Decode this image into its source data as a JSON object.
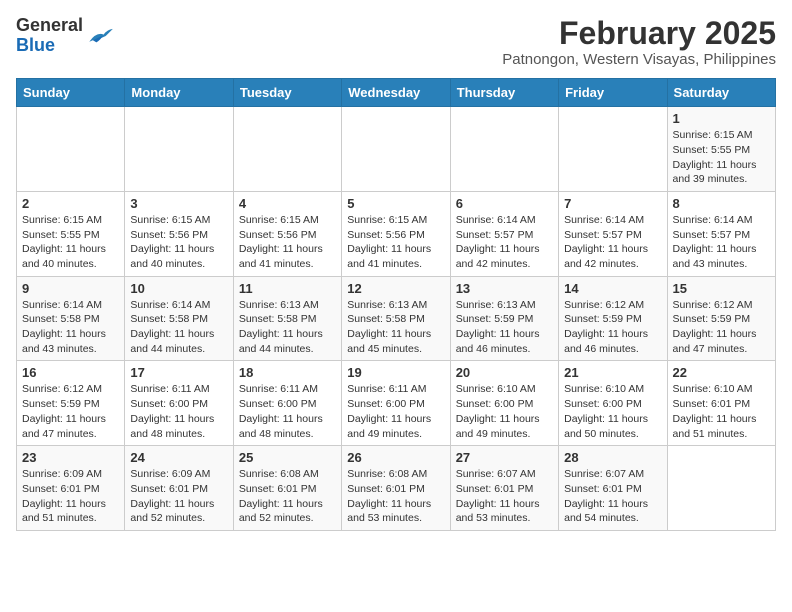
{
  "header": {
    "logo_general": "General",
    "logo_blue": "Blue",
    "title": "February 2025",
    "subtitle": "Patnongon, Western Visayas, Philippines"
  },
  "calendar": {
    "days_of_week": [
      "Sunday",
      "Monday",
      "Tuesday",
      "Wednesday",
      "Thursday",
      "Friday",
      "Saturday"
    ],
    "weeks": [
      [
        {
          "day": "",
          "info": ""
        },
        {
          "day": "",
          "info": ""
        },
        {
          "day": "",
          "info": ""
        },
        {
          "day": "",
          "info": ""
        },
        {
          "day": "",
          "info": ""
        },
        {
          "day": "",
          "info": ""
        },
        {
          "day": "1",
          "info": "Sunrise: 6:15 AM\nSunset: 5:55 PM\nDaylight: 11 hours and 39 minutes."
        }
      ],
      [
        {
          "day": "2",
          "info": "Sunrise: 6:15 AM\nSunset: 5:55 PM\nDaylight: 11 hours and 40 minutes."
        },
        {
          "day": "3",
          "info": "Sunrise: 6:15 AM\nSunset: 5:56 PM\nDaylight: 11 hours and 40 minutes."
        },
        {
          "day": "4",
          "info": "Sunrise: 6:15 AM\nSunset: 5:56 PM\nDaylight: 11 hours and 41 minutes."
        },
        {
          "day": "5",
          "info": "Sunrise: 6:15 AM\nSunset: 5:56 PM\nDaylight: 11 hours and 41 minutes."
        },
        {
          "day": "6",
          "info": "Sunrise: 6:14 AM\nSunset: 5:57 PM\nDaylight: 11 hours and 42 minutes."
        },
        {
          "day": "7",
          "info": "Sunrise: 6:14 AM\nSunset: 5:57 PM\nDaylight: 11 hours and 42 minutes."
        },
        {
          "day": "8",
          "info": "Sunrise: 6:14 AM\nSunset: 5:57 PM\nDaylight: 11 hours and 43 minutes."
        }
      ],
      [
        {
          "day": "9",
          "info": "Sunrise: 6:14 AM\nSunset: 5:58 PM\nDaylight: 11 hours and 43 minutes."
        },
        {
          "day": "10",
          "info": "Sunrise: 6:14 AM\nSunset: 5:58 PM\nDaylight: 11 hours and 44 minutes."
        },
        {
          "day": "11",
          "info": "Sunrise: 6:13 AM\nSunset: 5:58 PM\nDaylight: 11 hours and 44 minutes."
        },
        {
          "day": "12",
          "info": "Sunrise: 6:13 AM\nSunset: 5:58 PM\nDaylight: 11 hours and 45 minutes."
        },
        {
          "day": "13",
          "info": "Sunrise: 6:13 AM\nSunset: 5:59 PM\nDaylight: 11 hours and 46 minutes."
        },
        {
          "day": "14",
          "info": "Sunrise: 6:12 AM\nSunset: 5:59 PM\nDaylight: 11 hours and 46 minutes."
        },
        {
          "day": "15",
          "info": "Sunrise: 6:12 AM\nSunset: 5:59 PM\nDaylight: 11 hours and 47 minutes."
        }
      ],
      [
        {
          "day": "16",
          "info": "Sunrise: 6:12 AM\nSunset: 5:59 PM\nDaylight: 11 hours and 47 minutes."
        },
        {
          "day": "17",
          "info": "Sunrise: 6:11 AM\nSunset: 6:00 PM\nDaylight: 11 hours and 48 minutes."
        },
        {
          "day": "18",
          "info": "Sunrise: 6:11 AM\nSunset: 6:00 PM\nDaylight: 11 hours and 48 minutes."
        },
        {
          "day": "19",
          "info": "Sunrise: 6:11 AM\nSunset: 6:00 PM\nDaylight: 11 hours and 49 minutes."
        },
        {
          "day": "20",
          "info": "Sunrise: 6:10 AM\nSunset: 6:00 PM\nDaylight: 11 hours and 49 minutes."
        },
        {
          "day": "21",
          "info": "Sunrise: 6:10 AM\nSunset: 6:00 PM\nDaylight: 11 hours and 50 minutes."
        },
        {
          "day": "22",
          "info": "Sunrise: 6:10 AM\nSunset: 6:01 PM\nDaylight: 11 hours and 51 minutes."
        }
      ],
      [
        {
          "day": "23",
          "info": "Sunrise: 6:09 AM\nSunset: 6:01 PM\nDaylight: 11 hours and 51 minutes."
        },
        {
          "day": "24",
          "info": "Sunrise: 6:09 AM\nSunset: 6:01 PM\nDaylight: 11 hours and 52 minutes."
        },
        {
          "day": "25",
          "info": "Sunrise: 6:08 AM\nSunset: 6:01 PM\nDaylight: 11 hours and 52 minutes."
        },
        {
          "day": "26",
          "info": "Sunrise: 6:08 AM\nSunset: 6:01 PM\nDaylight: 11 hours and 53 minutes."
        },
        {
          "day": "27",
          "info": "Sunrise: 6:07 AM\nSunset: 6:01 PM\nDaylight: 11 hours and 53 minutes."
        },
        {
          "day": "28",
          "info": "Sunrise: 6:07 AM\nSunset: 6:01 PM\nDaylight: 11 hours and 54 minutes."
        },
        {
          "day": "",
          "info": ""
        }
      ]
    ]
  }
}
